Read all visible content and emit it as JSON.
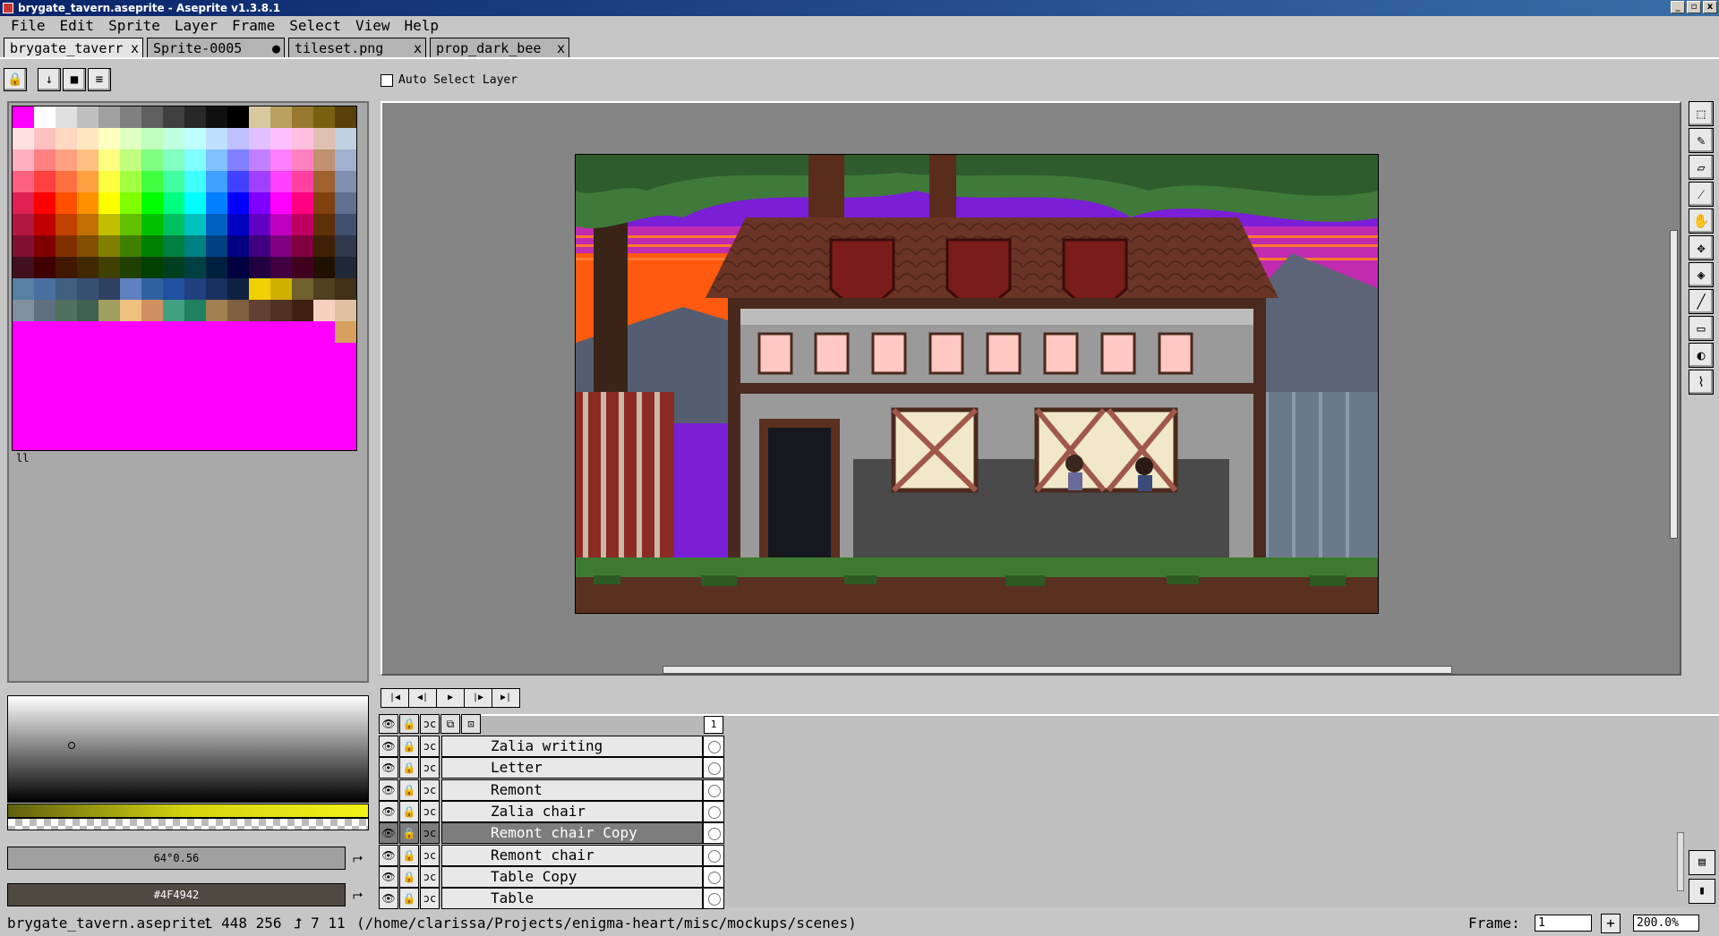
{
  "window": {
    "title": "brygate_tavern.aseprite - Aseprite v1.3.8.1",
    "buttons": [
      "_",
      "▫",
      "x"
    ]
  },
  "menu": [
    "File",
    "Edit",
    "Sprite",
    "Layer",
    "Frame",
    "Select",
    "View",
    "Help"
  ],
  "tabs": [
    {
      "label": "brygate_taverr",
      "close": "x"
    },
    {
      "label": "Sprite-0005",
      "close": "●"
    },
    {
      "label": "tileset.png",
      "close": "x"
    },
    {
      "label": "prop_dark_bee",
      "close": "x"
    }
  ],
  "toolbar_top": {
    "lock": "🔒",
    "down": "↓",
    "stop": "■",
    "menu": "≡"
  },
  "auto_select": {
    "label": "Auto Select Layer"
  },
  "palette": {
    "handle": "ll",
    "colors": [
      "#ff00ff",
      "#ffffff",
      "#e0e0e0",
      "#c0c0c0",
      "#a0a0a0",
      "#808080",
      "#606060",
      "#404040",
      "#282828",
      "#101010",
      "#000000",
      "#d8c8a0",
      "#b8a060",
      "#987830",
      "#786010",
      "#584008",
      "#ffe0e0",
      "#ffc0c0",
      "#ffd8c0",
      "#ffe8c0",
      "#ffffc0",
      "#e0ffc0",
      "#c0ffc0",
      "#c0ffe0",
      "#c0ffff",
      "#c0e0ff",
      "#c0c0ff",
      "#e0c0ff",
      "#ffc0ff",
      "#ffc0e0",
      "#e0c0b0",
      "#c0d0e0",
      "#ffb0c0",
      "#ff8080",
      "#ffa080",
      "#ffc080",
      "#ffff80",
      "#c0ff80",
      "#80ff80",
      "#80ffc0",
      "#80ffff",
      "#80c0ff",
      "#8080ff",
      "#c080ff",
      "#ff80ff",
      "#ff80c0",
      "#c09070",
      "#a0b0d0",
      "#ff6080",
      "#ff4040",
      "#ff7040",
      "#ffa040",
      "#ffff40",
      "#a0ff40",
      "#40ff40",
      "#40ffa0",
      "#40ffff",
      "#40a0ff",
      "#4040ff",
      "#a040ff",
      "#ff40ff",
      "#ff40a0",
      "#a06030",
      "#8090b0",
      "#e02050",
      "#ff0000",
      "#ff5000",
      "#ff9000",
      "#ffff00",
      "#80ff00",
      "#00ff00",
      "#00ff80",
      "#00ffff",
      "#0080ff",
      "#0000ff",
      "#8000ff",
      "#ff00ff",
      "#ff0080",
      "#804010",
      "#607090",
      "#b01840",
      "#c00000",
      "#c04000",
      "#c07000",
      "#c0c000",
      "#60c000",
      "#00c000",
      "#00c060",
      "#00c0c0",
      "#0060c0",
      "#0000c0",
      "#6000c0",
      "#c000c0",
      "#c00060",
      "#603008",
      "#405070",
      "#801030",
      "#800000",
      "#803000",
      "#805000",
      "#808000",
      "#408000",
      "#008000",
      "#008040",
      "#008080",
      "#004080",
      "#000080",
      "#400080",
      "#800080",
      "#800040",
      "#402004",
      "#303850",
      "#401020",
      "#400000",
      "#401800",
      "#402800",
      "#404000",
      "#204000",
      "#004000",
      "#004020",
      "#004040",
      "#002040",
      "#000040",
      "#200040",
      "#400040",
      "#400020",
      "#201000",
      "#202838",
      "#5880a0",
      "#4870a0",
      "#406080",
      "#385070",
      "#304060",
      "#6080c0",
      "#3060a0",
      "#2050a0",
      "#204080",
      "#183060",
      "#102040",
      "#f0d000",
      "#d0b000",
      "#706030",
      "#504020",
      "#403018",
      "#8090a0",
      "#607080",
      "#507060",
      "#406050",
      "#a0a060",
      "#f0c080",
      "#d09060",
      "#40a080",
      "#208060",
      "#a08050",
      "#806040",
      "#604030",
      "#503020",
      "#402010",
      "#f8d0c0",
      "#e0c0a0",
      "#ff00ff",
      "#ff00ff",
      "#ff00ff",
      "#ff00ff",
      "#ff00ff",
      "#ff00ff",
      "#ff00ff",
      "#ff00ff",
      "#ff00ff",
      "#ff00ff",
      "#ff00ff",
      "#ff00ff",
      "#ff00ff",
      "#ff00ff",
      "#ff00ff",
      "#d8a060",
      "#ff00ff",
      "#ff00ff",
      "#ff00ff",
      "#ff00ff",
      "#ff00ff",
      "#ff00ff",
      "#ff00ff",
      "#ff00ff",
      "#ff00ff",
      "#ff00ff",
      "#ff00ff",
      "#ff00ff",
      "#ff00ff",
      "#ff00ff",
      "#ff00ff",
      "#ff00ff",
      "#ff00ff",
      "#ff00ff",
      "#ff00ff",
      "#ff00ff",
      "#ff00ff",
      "#ff00ff",
      "#ff00ff",
      "#ff00ff",
      "#ff00ff",
      "#ff00ff",
      "#ff00ff",
      "#ff00ff",
      "#ff00ff",
      "#ff00ff",
      "#ff00ff",
      "#ff00ff",
      "#ff00ff",
      "#ff00ff",
      "#ff00ff",
      "#ff00ff",
      "#ff00ff",
      "#ff00ff",
      "#ff00ff",
      "#ff00ff",
      "#ff00ff",
      "#ff00ff",
      "#ff00ff",
      "#ff00ff",
      "#ff00ff",
      "#ff00ff",
      "#ff00ff",
      "#ff00ff",
      "#ff00ff",
      "#ff00ff",
      "#ff00ff",
      "#ff00ff",
      "#ff00ff",
      "#ff00ff",
      "#ff00ff",
      "#ff00ff",
      "#ff00ff",
      "#ff00ff",
      "#ff00ff",
      "#ff00ff",
      "#ff00ff",
      "#ff00ff",
      "#ff00ff",
      "#ff00ff",
      "#ff00ff",
      "#ff00ff",
      "#ff00ff",
      "#ff00ff",
      "#ff00ff",
      "#ff00ff",
      "#ff00ff",
      "#ff00ff",
      "#ff00ff",
      "#ff00ff",
      "#ff00ff",
      "#ff00ff",
      "#ff00ff",
      "#ff00ff",
      "#ff00ff",
      "#ff00ff"
    ]
  },
  "colors": {
    "foreground_label": "64°0.56",
    "background_label": "#4F4942",
    "background_hex": "#4f4942",
    "swap_icon": "⮣"
  },
  "tools": [
    {
      "name": "rectangular-marquee-icon",
      "glyph": "⬚"
    },
    {
      "name": "pencil-icon",
      "glyph": "✎"
    },
    {
      "name": "eraser-icon",
      "glyph": "▱"
    },
    {
      "name": "eyedropper-icon",
      "glyph": "⁄"
    },
    {
      "name": "hand-icon",
      "glyph": "✋"
    },
    {
      "name": "move-icon",
      "glyph": "✥"
    },
    {
      "name": "paint-bucket-icon",
      "glyph": "◈"
    },
    {
      "name": "line-icon",
      "glyph": "╱"
    },
    {
      "name": "rectangle-icon",
      "glyph": "▭"
    },
    {
      "name": "contour-icon",
      "glyph": "◐"
    },
    {
      "name": "blur-icon",
      "glyph": "⌇"
    }
  ],
  "anim_controls": [
    "|◀",
    "◀|",
    "▶",
    "|▶",
    "▶|"
  ],
  "timeline": {
    "header_icons": {
      "eye": "👁",
      "lock": "🔒",
      "continuous": "ɔc",
      "link": "⧉",
      "onion": "⊡"
    },
    "frame_number": "1",
    "layers": [
      {
        "name": "Zalia writing",
        "selected": false
      },
      {
        "name": "Letter",
        "selected": false
      },
      {
        "name": "Remont",
        "selected": false
      },
      {
        "name": "Zalia chair",
        "selected": false
      },
      {
        "name": "Remont chair Copy",
        "selected": true
      },
      {
        "name": "Remont chair",
        "selected": false
      },
      {
        "name": "Table Copy",
        "selected": false
      },
      {
        "name": "Table",
        "selected": false
      }
    ],
    "row_icons": {
      "eye": "👁",
      "lock": "🔒",
      "continuous": "ɔc"
    },
    "side_buttons": [
      "▤",
      "▮"
    ]
  },
  "status": {
    "filename": "brygate_tavern.aseprite",
    "position": "⮤ 448 256",
    "size": "⮥ 7 11",
    "path": "(/home/clarissa/Projects/enigma-heart/misc/mockups/scenes)",
    "frame_label": "Frame:",
    "frame_value": "1",
    "plus": "+",
    "zoom": "200.0%"
  }
}
